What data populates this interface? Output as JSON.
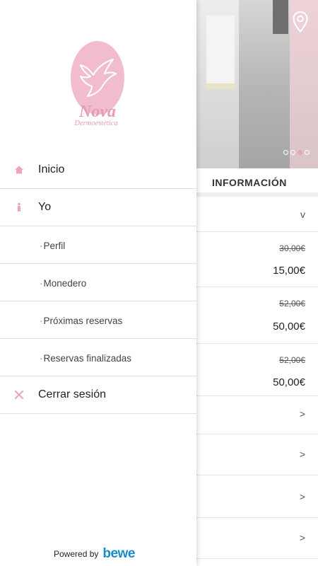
{
  "brand": {
    "name": "Nova",
    "subtitle": "Dermoestètica",
    "accent": "#f1bccd"
  },
  "menu": {
    "items": [
      {
        "label": "Inicio",
        "icon": "home-icon"
      },
      {
        "label": "Yo",
        "icon": "person-icon"
      },
      {
        "label": "Perfil",
        "icon": ""
      },
      {
        "label": "Monedero",
        "icon": ""
      },
      {
        "label": "Próximas reservas",
        "icon": ""
      },
      {
        "label": "Reservas finalizadas",
        "icon": ""
      },
      {
        "label": "Cerrar sesión",
        "icon": "close-icon"
      }
    ]
  },
  "footer": {
    "powered_by": "Powered by",
    "brand": "bewe"
  },
  "background": {
    "section_title": "INFORMACIÓN",
    "carousel": {
      "slides": 4,
      "active_index": 2
    },
    "prices": [
      {
        "old": "30,00€",
        "new": "15,00€"
      },
      {
        "old": "52,00€",
        "new": "50,00€"
      },
      {
        "old": "52,00€",
        "new": "50,00€"
      }
    ],
    "collapse_symbol": "v",
    "arrow_symbol": ">"
  }
}
